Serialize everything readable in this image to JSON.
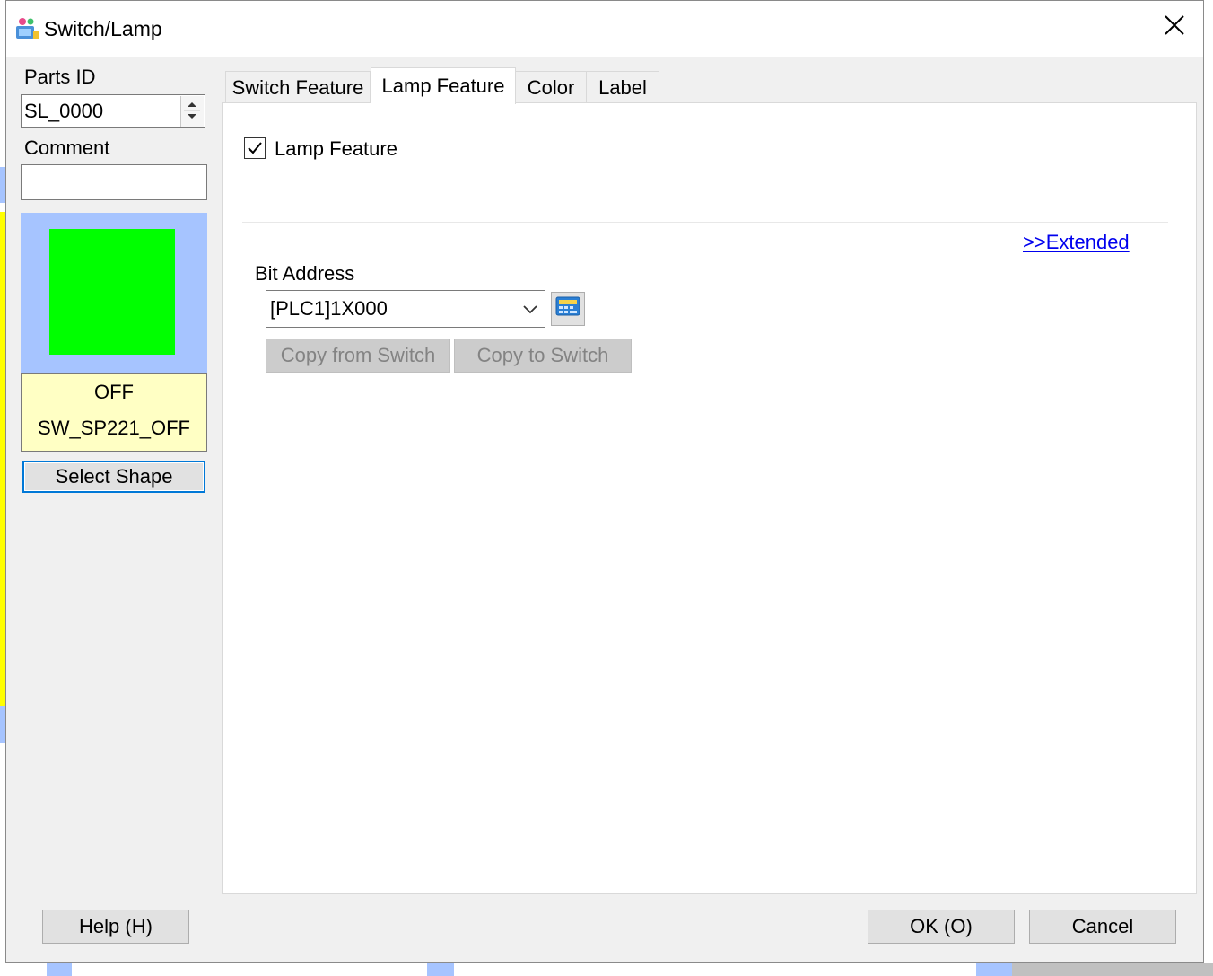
{
  "window": {
    "title": "Switch/Lamp",
    "app_icon": "switch-lamp-app-icon",
    "close_icon": "close-icon"
  },
  "sidebar": {
    "parts_id_label": "Parts ID",
    "parts_id_value": "SL_0000",
    "comment_label": "Comment",
    "comment_value": "",
    "preview": {
      "lamp_color": "#00ff00",
      "background_color": "#a6c4ff",
      "state": "OFF",
      "shape_name": "SW_SP221_OFF"
    },
    "select_shape_label": "Select Shape"
  },
  "tabs": [
    {
      "label": "Switch Feature",
      "active": false
    },
    {
      "label": "Lamp Feature",
      "active": true
    },
    {
      "label": "Color",
      "active": false
    },
    {
      "label": "Label",
      "active": false
    }
  ],
  "lamp_feature": {
    "checkbox_label": "Lamp Feature",
    "checked": true,
    "extended_link": ">>Extended",
    "bit_address_label": "Bit Address",
    "bit_address_value": "[PLC1]1X000",
    "address_button_icon": "address-keypad-icon",
    "copy_from_switch_label": "Copy from Switch",
    "copy_to_switch_label": "Copy to Switch"
  },
  "footer": {
    "help_label": "Help (H)",
    "ok_label": "OK (O)",
    "cancel_label": "Cancel"
  }
}
